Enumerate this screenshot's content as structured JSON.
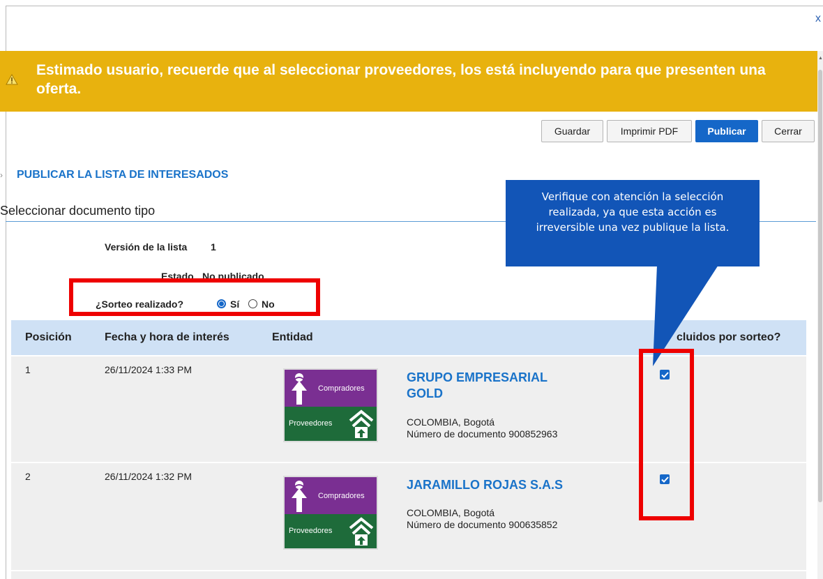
{
  "window": {
    "close_label": "x"
  },
  "banner": {
    "text": "Estimado usuario, recuerde que al seleccionar proveedores, los está incluyendo para que presenten una oferta."
  },
  "toolbar": {
    "guardar": "Guardar",
    "imprimir": "Imprimir PDF",
    "publicar": "Publicar",
    "cerrar": "Cerrar"
  },
  "section": {
    "title": "PUBLICAR LA LISTA DE INTERESADOS",
    "subtitle": "Seleccionar documento tipo"
  },
  "info": {
    "version_label": "Versión de la lista",
    "version_value": "1",
    "estado_label": "Estado",
    "estado_value": "No publicado",
    "sorteo_label": "¿Sorteo realizado?",
    "sorteo_si": "Sí",
    "sorteo_no": "No",
    "sorteo_selected": "Sí"
  },
  "tooltip": {
    "text": "Verifique con atención la selección realizada, ya que esta acción es irreversible una vez publique la lista."
  },
  "table": {
    "headers": {
      "posicion": "Posición",
      "fecha": "Fecha y hora de interés",
      "entidad": "Entidad",
      "incluidos": "cluidos por sorteo?"
    },
    "rows": [
      {
        "posicion": "1",
        "fecha": "26/11/2024 1:33 PM",
        "name_line1": "GRUPO EMPRESARIAL",
        "name_line2": "GOLD",
        "location": "COLOMBIA, Bogotá",
        "documento": "Número de documento 900852963",
        "checked": true
      },
      {
        "posicion": "2",
        "fecha": "26/11/2024 1:32 PM",
        "name_line1": "JARAMILLO ROJAS S.A.S",
        "location": "COLOMBIA, Bogotá",
        "documento": "Número de documento 900635852",
        "checked": true
      }
    ]
  },
  "logo": {
    "compradores": "Compradores",
    "proveedores": "Proveedores"
  },
  "icons": {
    "warning": "warning-icon",
    "close": "close-icon",
    "check": "check-icon",
    "person": "person-up-icon",
    "house": "house-arrow-icon"
  },
  "colors": {
    "banner": "#e8b20e",
    "primary": "#1567c8",
    "link": "#1a73c9",
    "tooltip": "#1255b7",
    "highlight": "#ee0000",
    "table_header": "#cfe1f5",
    "purple": "#7a2f92",
    "green": "#1e6b3a"
  }
}
